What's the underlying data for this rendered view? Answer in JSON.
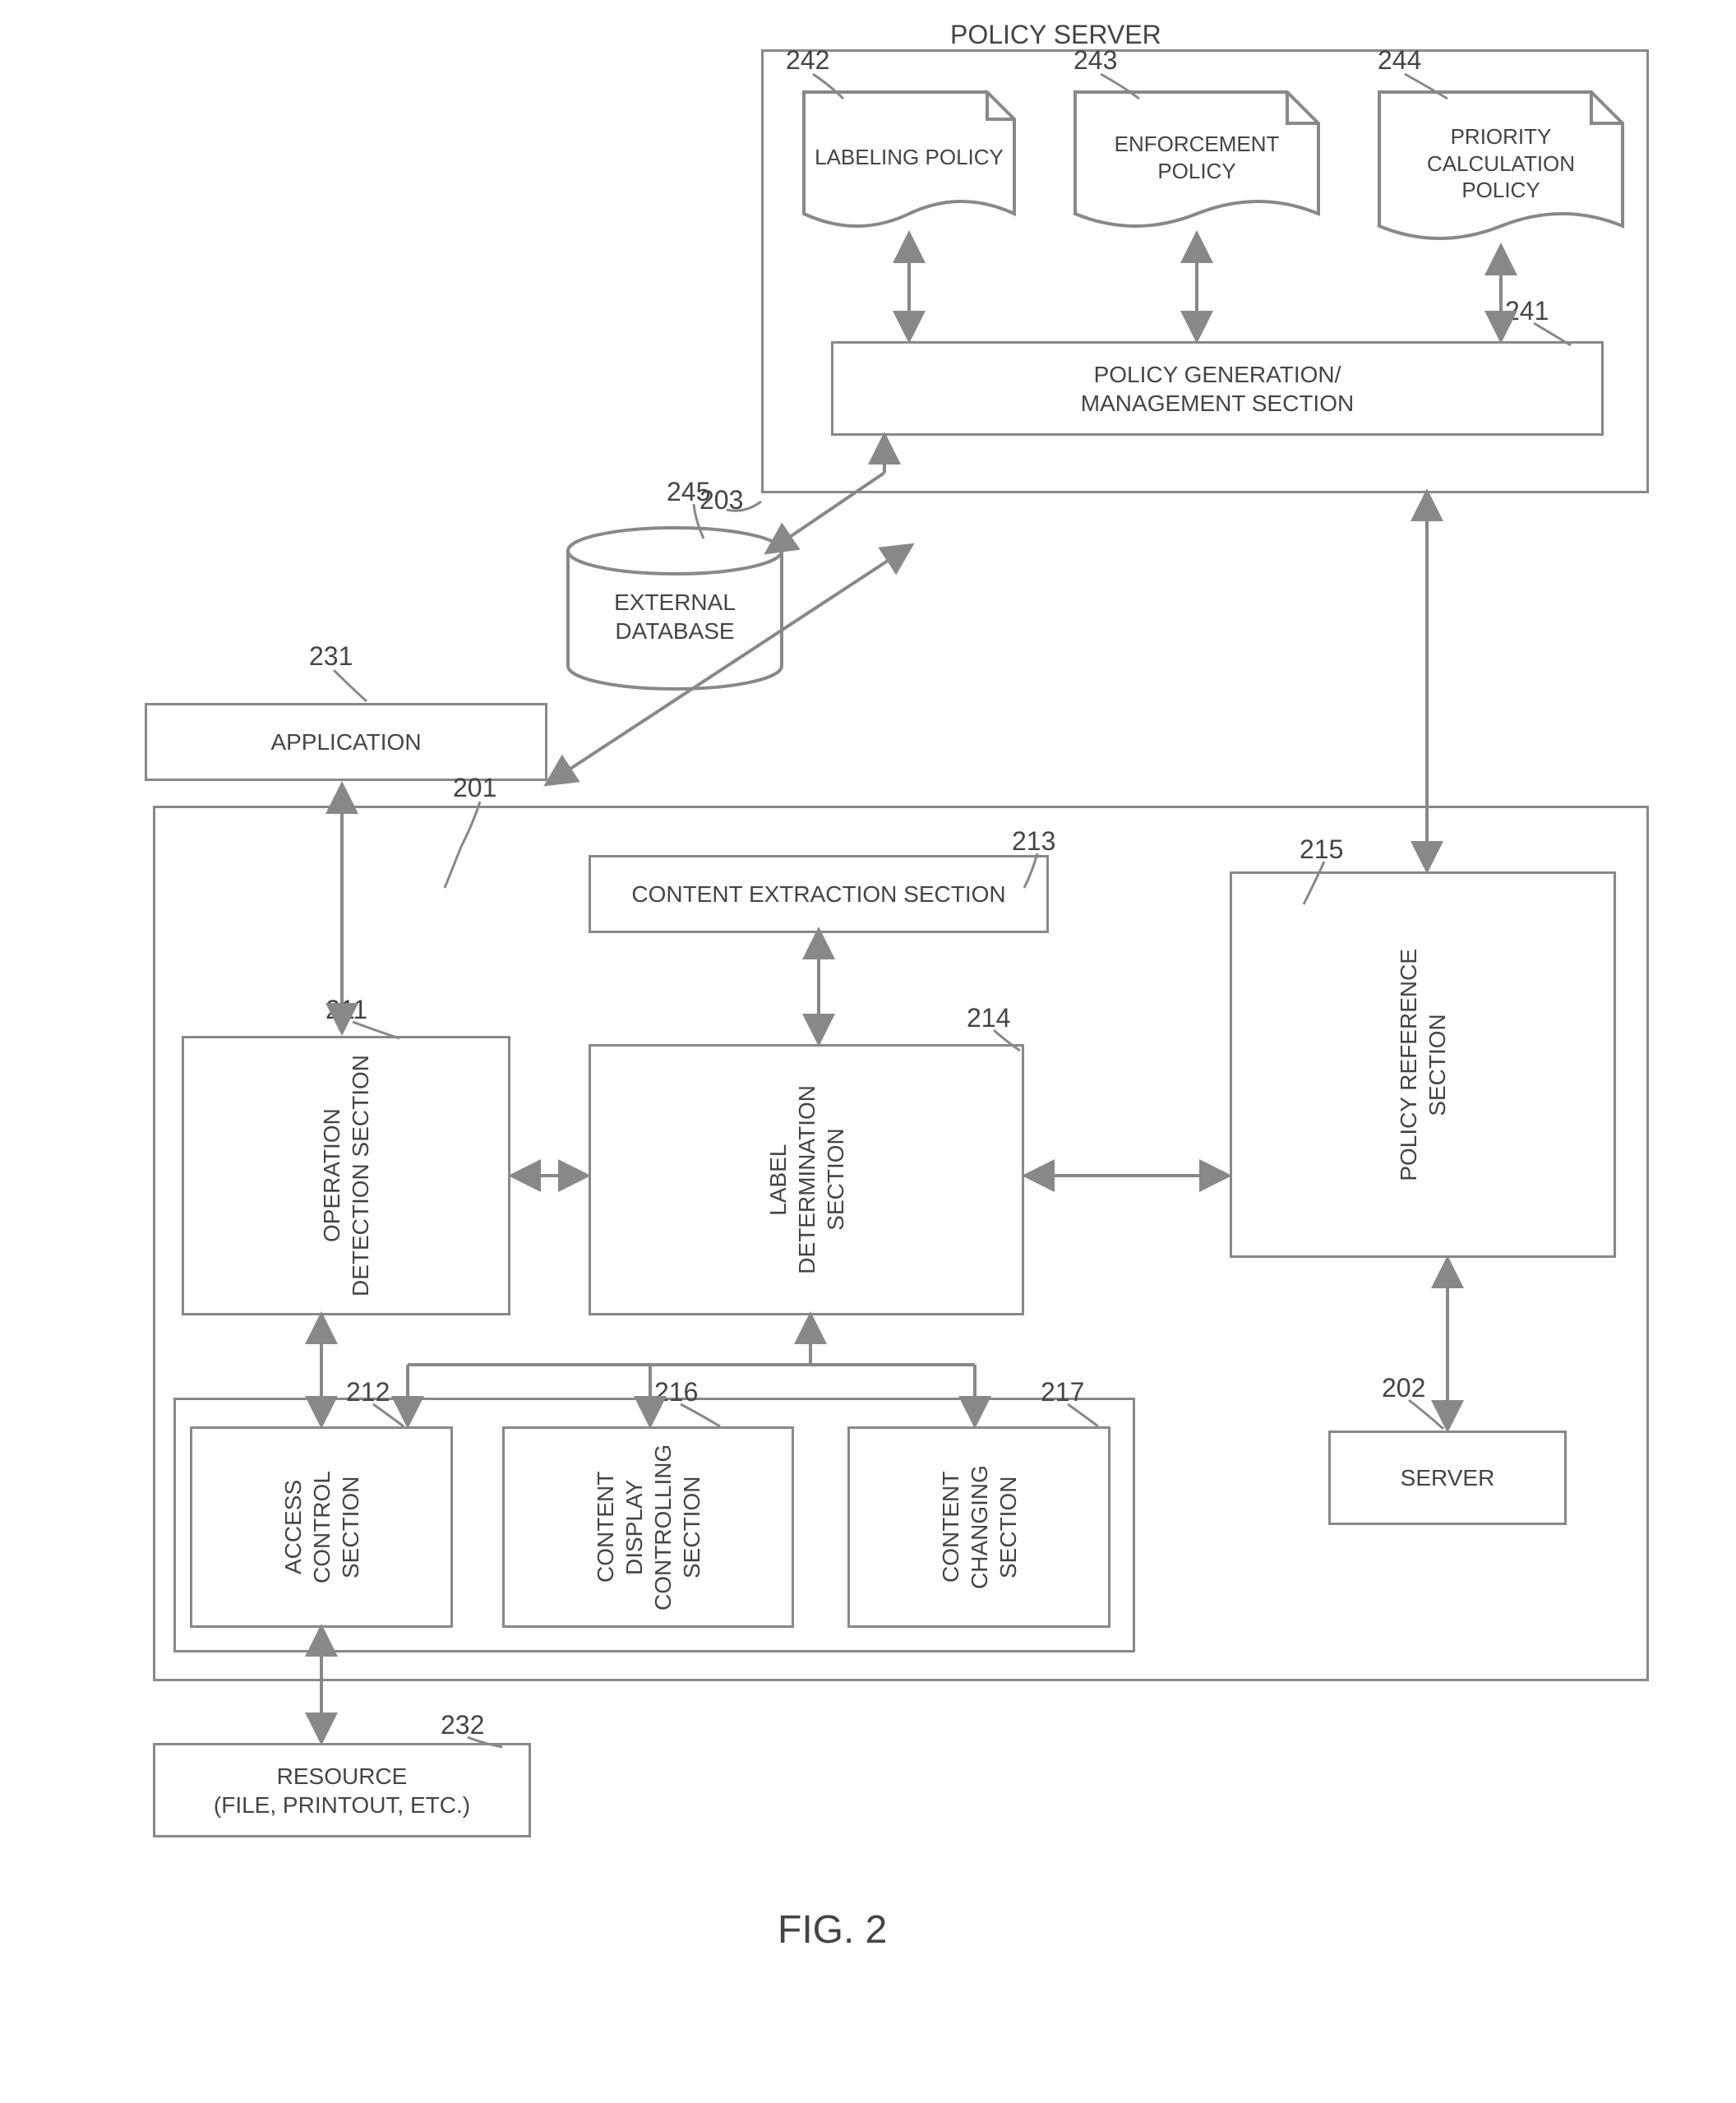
{
  "figure": "FIG. 2",
  "refs": {
    "r201": "201",
    "r202": "202",
    "r203": "203",
    "r211": "211",
    "r212": "212",
    "r213": "213",
    "r214": "214",
    "r215": "215",
    "r216": "216",
    "r217": "217",
    "r231": "231",
    "r232": "232",
    "r241": "241",
    "r242": "242",
    "r243": "243",
    "r244": "244",
    "r245": "245"
  },
  "blocks": {
    "application": "APPLICATION",
    "operation_detection": "OPERATION\nDETECTION SECTION",
    "access_control": "ACCESS CONTROL\nSECTION",
    "content_extraction": "CONTENT EXTRACTION SECTION",
    "label_determination": "LABEL\nDETERMINATION\nSECTION",
    "policy_reference": "POLICY REFERENCE\nSECTION",
    "content_display_controlling": "CONTENT DISPLAY\nCONTROLLING\nSECTION",
    "content_changing": "CONTENT\nCHANGING SECTION",
    "resource": "RESOURCE\n(FILE, PRINTOUT, ETC.)",
    "server": "SERVER",
    "policy_server": "POLICY SERVER",
    "policy_gen_mgmt": "POLICY GENERATION/\nMANAGEMENT SECTION",
    "labeling_policy": "LABELING\nPOLICY",
    "enforcement_policy": "ENFORCEMENT\nPOLICY",
    "priority_calc_policy": "PRIORITY\nCALCULATION\nPOLICY",
    "external_database": "EXTERNAL\nDATABASE"
  }
}
